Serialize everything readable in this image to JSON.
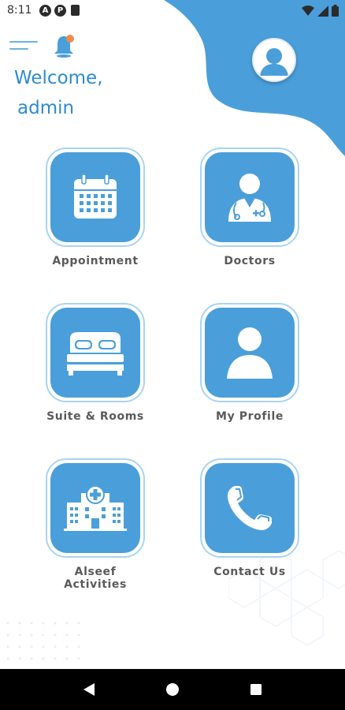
{
  "status_bar": {
    "time": "8:11",
    "left_icons": [
      "notification-a-icon",
      "notification-p-icon",
      "sd-card-icon"
    ],
    "right_icons": [
      "wifi-icon",
      "signal-icon",
      "battery-icon"
    ]
  },
  "header": {
    "welcome": "Welcome,",
    "username": "admin"
  },
  "colors": {
    "primary": "#4a9fda",
    "accent_text": "#2e8bd0",
    "tile_border": "#a9d4f0",
    "bell_dot": "#f08a4b"
  },
  "tiles": [
    {
      "label": "Appointment",
      "icon": "calendar-icon"
    },
    {
      "label": "Doctors",
      "icon": "doctor-icon"
    },
    {
      "label": "Suite & Rooms",
      "icon": "bed-icon"
    },
    {
      "label": "My Profile",
      "icon": "profile-icon"
    },
    {
      "label": "Alseef Activities",
      "icon": "hospital-icon"
    },
    {
      "label": "Contact Us",
      "icon": "phone-icon"
    }
  ],
  "nav": [
    "back-icon",
    "home-icon",
    "recents-icon"
  ]
}
